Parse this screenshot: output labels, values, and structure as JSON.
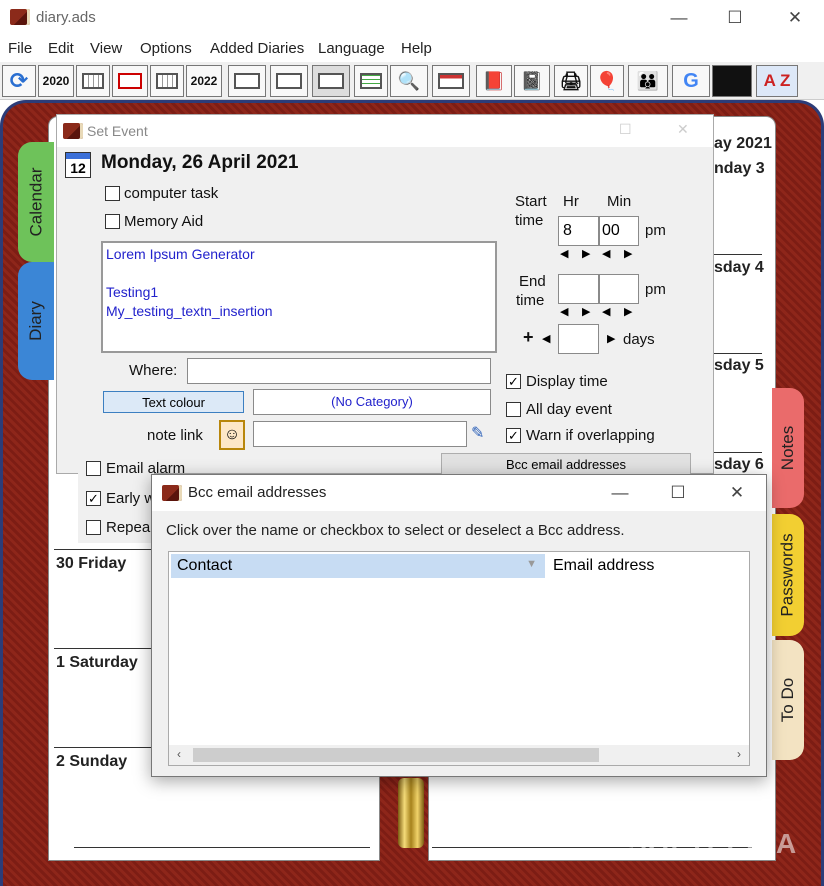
{
  "window": {
    "title": "diary.ads",
    "controls": [
      "—",
      "☐",
      "✕"
    ]
  },
  "menu": [
    "File",
    "Edit",
    "View",
    "Options",
    "Added Diaries",
    "Language",
    "Help"
  ],
  "toolbar": {
    "year_prev": "2020",
    "year_next": "2022",
    "az": "A Z"
  },
  "diary": {
    "left_days": [
      "30 Friday",
      "1 Saturday",
      "2 Sunday"
    ],
    "right_fragments": [
      "ay 2021",
      "nday 3",
      "sday 4",
      "sday 5",
      "sday 6"
    ],
    "tabs_left": [
      "Calendar",
      "Diary"
    ],
    "tabs_right": [
      "Notes",
      "Passwords",
      "To Do"
    ]
  },
  "set_event": {
    "title": "Set Event",
    "date_icon": "12",
    "date": "Monday, 26 April 2021",
    "computer_task": "computer task",
    "memory_aid": "Memory Aid",
    "note_lines": [
      "Lorem Ipsum Generator",
      "",
      "Testing1",
      "My_testing_textn_insertion"
    ],
    "where_label": "Where:",
    "text_colour": "Text colour",
    "category": "(No Category)",
    "note_link": "note link",
    "start_label_1": "Start",
    "start_label_2": "time",
    "hr_label": "Hr",
    "min_label": "Min",
    "start_hr": "8",
    "start_min": "00",
    "pm": "pm",
    "end_label_1": "End",
    "end_label_2": "time",
    "days_label": "days",
    "plus": "+",
    "display_time": "Display time",
    "all_day": "All day event",
    "warn_overlap": "Warn if overlapping",
    "bcc_button": "Bcc email addresses",
    "email_alarm": "Email alarm",
    "early_w": "Early w",
    "repea": "Repea"
  },
  "bcc": {
    "title": "Bcc email addresses",
    "instruction": "Click over the name or checkbox to select or deselect a Bcc address.",
    "col_contact": "Contact",
    "col_email": "Email address"
  },
  "watermark": "SOFTPEDIA"
}
